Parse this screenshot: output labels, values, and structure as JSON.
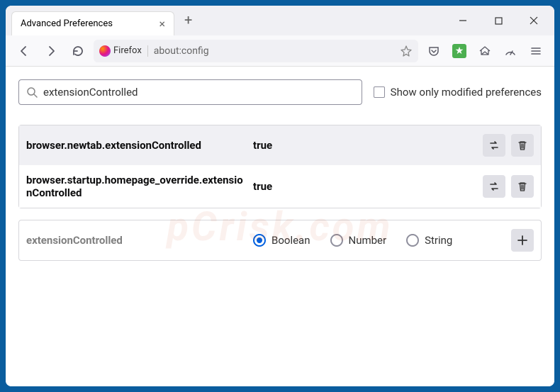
{
  "window": {
    "tab_title": "Advanced Preferences",
    "url_label": "Firefox",
    "url": "about:config"
  },
  "search": {
    "value": "extensionControlled",
    "modified_only_label": "Show only modified preferences"
  },
  "prefs": [
    {
      "name": "browser.newtab.extensionControlled",
      "value": "true"
    },
    {
      "name": "browser.startup.homepage_override.extensionControlled",
      "value": "true"
    }
  ],
  "new_pref": {
    "name": "extensionControlled",
    "types": {
      "boolean": "Boolean",
      "number": "Number",
      "string": "String"
    },
    "selected": "boolean"
  },
  "watermark": "pCrisk.com"
}
